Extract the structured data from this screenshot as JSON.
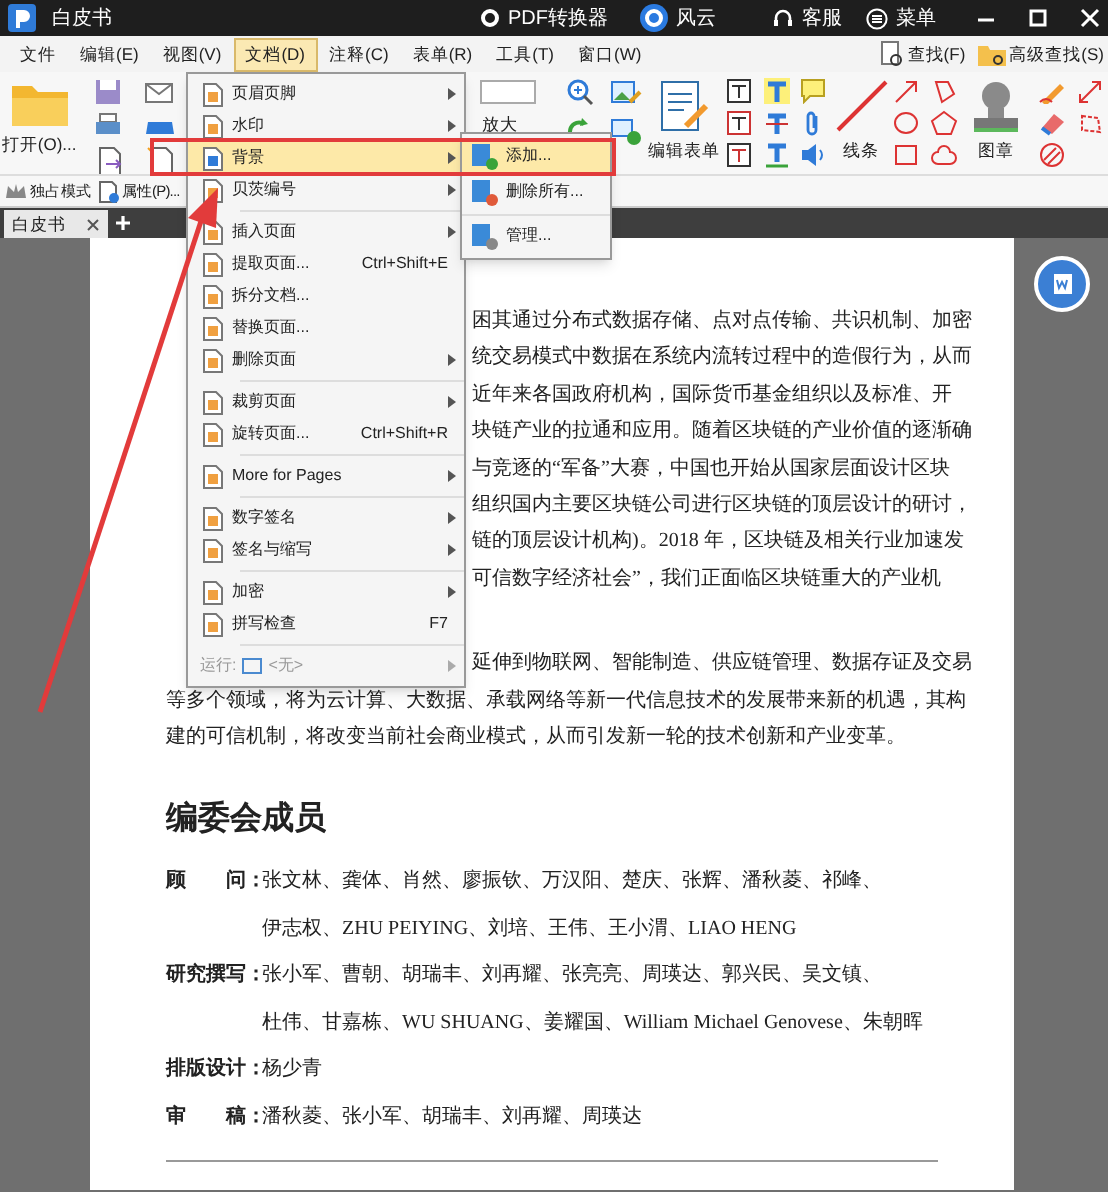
{
  "title_bar": {
    "app_title": "白皮书",
    "converter": "PDF转换器",
    "brand": "风云",
    "support": "客服",
    "menu": "菜单"
  },
  "menu_bar": {
    "items": [
      {
        "label": "文件",
        "selected": false
      },
      {
        "label": "编辑(E)",
        "selected": false
      },
      {
        "label": "视图(V)",
        "selected": false
      },
      {
        "label": "文档(D)",
        "selected": true
      },
      {
        "label": "注释(C)",
        "selected": false
      },
      {
        "label": "表单(R)",
        "selected": false
      },
      {
        "label": "工具(T)",
        "selected": false
      },
      {
        "label": "窗口(W)",
        "selected": false
      }
    ],
    "find": "查找(F)",
    "advanced_find": "高级查找(S)"
  },
  "toolbar": {
    "open": "打开(O)...",
    "zoom": "放大",
    "edit_form": "编辑表单",
    "lines": "线条",
    "stamp": "图章",
    "exclusive_mode": "独占模式",
    "properties": "属性(P)..."
  },
  "tabs": [
    {
      "label": "白皮书",
      "selected": true
    }
  ],
  "document_menu": [
    {
      "kind": "item",
      "label": "页眉页脚",
      "submenu": true,
      "selected": false
    },
    {
      "kind": "item",
      "label": "水印",
      "submenu": true,
      "selected": false
    },
    {
      "kind": "item",
      "label": "背景",
      "submenu": true,
      "selected": true
    },
    {
      "kind": "item",
      "label": "贝茨编号",
      "submenu": true,
      "selected": false
    },
    {
      "kind": "separator"
    },
    {
      "kind": "item",
      "label": "插入页面",
      "submenu": true,
      "selected": false
    },
    {
      "kind": "item",
      "label": "提取页面...",
      "shortcut": "Ctrl+Shift+E",
      "submenu": false,
      "selected": false
    },
    {
      "kind": "item",
      "label": "拆分文档...",
      "submenu": false,
      "selected": false
    },
    {
      "kind": "item",
      "label": "替换页面...",
      "submenu": false,
      "selected": false
    },
    {
      "kind": "item",
      "label": "删除页面",
      "submenu": true,
      "selected": false
    },
    {
      "kind": "separator"
    },
    {
      "kind": "item",
      "label": "裁剪页面",
      "submenu": true,
      "selected": false
    },
    {
      "kind": "item",
      "label": "旋转页面...",
      "shortcut": "Ctrl+Shift+R",
      "submenu": false,
      "selected": false
    },
    {
      "kind": "separator"
    },
    {
      "kind": "item",
      "label": "More for Pages",
      "submenu": true,
      "selected": false
    },
    {
      "kind": "separator"
    },
    {
      "kind": "item",
      "label": "数字签名",
      "submenu": true,
      "selected": false
    },
    {
      "kind": "item",
      "label": "签名与缩写",
      "submenu": true,
      "selected": false
    },
    {
      "kind": "separator"
    },
    {
      "kind": "item",
      "label": "加密",
      "submenu": true,
      "selected": false
    },
    {
      "kind": "item",
      "label": "拼写检查",
      "shortcut": "F7",
      "submenu": false,
      "selected": false
    },
    {
      "kind": "separator"
    },
    {
      "kind": "run",
      "label": "运行:",
      "value": "<无>",
      "submenu": true,
      "disabled": true
    }
  ],
  "background_submenu": [
    {
      "kind": "item",
      "label": "添加...",
      "selected": true
    },
    {
      "kind": "item",
      "label": "删除所有...",
      "selected": false
    },
    {
      "kind": "separator"
    },
    {
      "kind": "item",
      "label": "管理...",
      "selected": false
    }
  ],
  "document": {
    "paragraph_1": [
      "困其通过分布式数据存储、点对点传输、共识机制、加密",
      "统交易模式中数据在系统内流转过程中的造假行为，从而",
      "近年来各国政府机构，国际货币基金组织以及标准、开",
      "块链产业的拉通和应用。随着区块链的产业价值的逐渐确",
      "与竞逐的“军备”大赛，中国也开始从国家层面设计区块",
      "组织国内主要区块链公司进行区块链的顶层设计的研讨，",
      "链的顶层设计机构)。2018 年，区块链及相关行业加速发",
      "可信数字经济社会”，我们正面临区块链重大的产业机"
    ],
    "paragraph_2": [
      "延伸到物联网、智能制造、供应链管理、数据存证及交易",
      "等多个领域，将为云计算、大数据、承载网络等新一代信息技术的发展带来新的机遇，其构",
      "建的可信机制，将改变当前社会商业模式，从而引发新一轮的技术创新和产业变革。"
    ],
    "heading": "编委会成员",
    "members": [
      {
        "role": "顾　　问：",
        "lines": [
          "张文林、龚体、肖然、廖振钦、万汉阳、楚庆、张辉、潘秋菱、祁峰、",
          "伊志权、ZHU PEIYING、刘培、王伟、王小渭、LIAO HENG"
        ]
      },
      {
        "role": "研究撰写：",
        "lines": [
          "张小军、曹朝、胡瑞丰、刘再耀、张亮亮、周瑛达、郭兴民、吴文镇、",
          "杜伟、甘嘉栋、WU SHUANG、姜耀国、William Michael Genovese、朱朝晖"
        ]
      },
      {
        "role": "排版设计：",
        "lines": [
          "杨少青"
        ]
      },
      {
        "role": "审　　稿：",
        "lines": [
          "潘秋菱、张小军、胡瑞丰、刘再耀、周瑛达"
        ]
      }
    ]
  }
}
